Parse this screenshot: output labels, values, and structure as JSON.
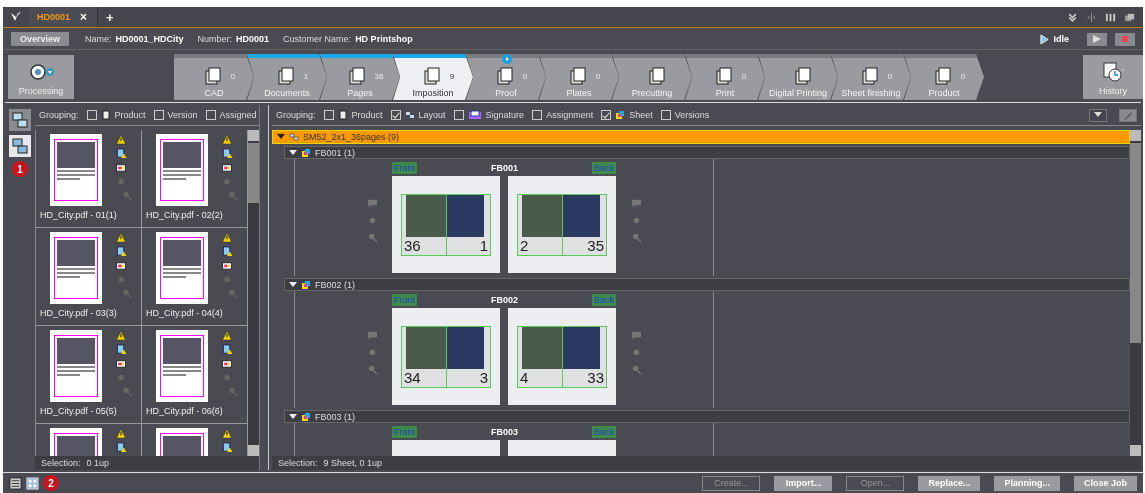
{
  "tabs": [
    {
      "label": "HD0001",
      "selected": true,
      "close": "×"
    }
  ],
  "new_tab": "+",
  "info": {
    "overview": "Overview",
    "fields": [
      {
        "label": "Name:",
        "value": "HD0001_HDCity"
      },
      {
        "label": "Number:",
        "value": "HD0001"
      },
      {
        "label": "Customer Name:",
        "value": "HD Printshop"
      }
    ],
    "status": "Idle"
  },
  "processing": {
    "label": "Processing"
  },
  "workflow_steps": [
    {
      "label": "CAD",
      "count": "0",
      "selected": false,
      "progress": false,
      "running": false
    },
    {
      "label": "Documents",
      "count": "1",
      "selected": false,
      "progress": true,
      "running": false
    },
    {
      "label": "Pages",
      "count": "36",
      "selected": false,
      "progress": true,
      "running": false
    },
    {
      "label": "Imposition",
      "count": "9",
      "selected": true,
      "progress": true,
      "running": false
    },
    {
      "label": "Proof",
      "count": "0",
      "selected": false,
      "progress": false,
      "running": true
    },
    {
      "label": "Plates",
      "count": "0",
      "selected": false,
      "progress": false,
      "running": false
    },
    {
      "label": "Precutting",
      "selected": false,
      "progress": false,
      "running": false
    },
    {
      "label": "Print",
      "count": "0",
      "selected": false,
      "progress": false,
      "running": false
    },
    {
      "label": "Digital Printing",
      "selected": false,
      "progress": false,
      "running": false
    },
    {
      "label": "Sheet finishing",
      "count": "0",
      "selected": false,
      "progress": false,
      "running": false
    },
    {
      "label": "Product",
      "count": "0",
      "selected": false,
      "progress": false,
      "running": false
    }
  ],
  "history": {
    "label": "History"
  },
  "markers": [
    "1",
    "2"
  ],
  "left_panel": {
    "grouping_label": "Grouping:",
    "grouping": [
      {
        "label": "Product",
        "checked": false
      },
      {
        "label": "Version",
        "checked": false
      },
      {
        "label": "Assigned",
        "checked": false
      }
    ],
    "pages": [
      {
        "kind": "page",
        "name": "HD_City.pdf - 01(1)"
      },
      {
        "kind": "page",
        "name": "HD_City.pdf - 02(2)"
      },
      {
        "kind": "page",
        "name": "HD_City.pdf - 03(3)"
      },
      {
        "kind": "page",
        "name": "HD_City.pdf - 04(4)"
      },
      {
        "kind": "page",
        "name": "HD_City.pdf - 05(5)"
      },
      {
        "kind": "page",
        "name": "HD_City.pdf - 06(6)"
      },
      {
        "kind": "page"
      },
      {
        "kind": "page"
      }
    ],
    "selection_label": "Selection:",
    "selection": "0 1up"
  },
  "right_panel": {
    "grouping_label": "Grouping:",
    "grouping": [
      {
        "label": "Product",
        "checked": false
      },
      {
        "label": "Layout",
        "checked": true
      },
      {
        "label": "Signature",
        "checked": false
      },
      {
        "label": "Assignment",
        "checked": false
      },
      {
        "label": "Sheet",
        "checked": true
      },
      {
        "label": "Versions",
        "checked": false
      }
    ],
    "tree": [
      {
        "label": "SM52_2x1_36pages (9)",
        "expanded": true,
        "children": [
          {
            "label": "FB001 (1)",
            "expanded": true,
            "sheet": {
              "title": "FB001",
              "front_label": "Front",
              "back_label": "Back",
              "front_pages": [
                "36",
                "1"
              ],
              "back_pages": [
                "2",
                "35"
              ]
            }
          },
          {
            "label": "FB002 (1)",
            "expanded": true,
            "sheet": {
              "title": "FB002",
              "front_label": "Front",
              "back_label": "Back",
              "front_pages": [
                "34",
                "3"
              ],
              "back_pages": [
                "4",
                "33"
              ]
            }
          },
          {
            "label": "FB003 (1)",
            "expanded": true,
            "sheet": {
              "title": "FB003",
              "front_label": "Front",
              "back_label": "Back"
            }
          }
        ]
      }
    ],
    "selection_label": "Selection:",
    "selection": "9 Sheet,  0 1up"
  },
  "buttons": [
    {
      "label": "Create...",
      "disabled": true
    },
    {
      "label": "Import...",
      "disabled": false
    },
    {
      "label": "Open...",
      "disabled": true
    },
    {
      "label": "Replace...",
      "disabled": false
    },
    {
      "label": "Planning...",
      "disabled": false
    },
    {
      "label": "Close Job",
      "disabled": false
    }
  ]
}
